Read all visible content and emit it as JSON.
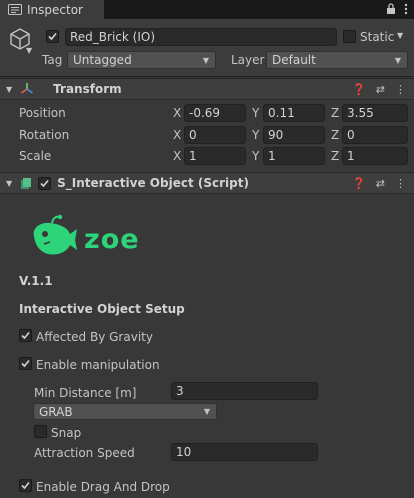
{
  "tab": {
    "title": "Inspector"
  },
  "header": {
    "object_name": "Red_Brick (IO)",
    "active": true,
    "static_label": "Static",
    "static_checked": false,
    "tag_label": "Tag",
    "tag_value": "Untagged",
    "layer_label": "Layer",
    "layer_value": "Default"
  },
  "transform": {
    "title": "Transform",
    "rows": [
      {
        "label": "Position",
        "x": "-0.69",
        "y": "0.11",
        "z": "3.55"
      },
      {
        "label": "Rotation",
        "x": "0",
        "y": "90",
        "z": "0"
      },
      {
        "label": "Scale",
        "x": "1",
        "y": "1",
        "z": "1"
      }
    ],
    "axis": {
      "x": "X",
      "y": "Y",
      "z": "Z"
    }
  },
  "script": {
    "title": "S_Interactive Object (Script)",
    "enabled": true,
    "logo_text": "zoe",
    "version": "V.1.1",
    "section_title": "Interactive Object Setup",
    "affected_by_gravity": {
      "label": "Affected By Gravity",
      "checked": true
    },
    "enable_manipulation": {
      "label": "Enable manipulation",
      "checked": true
    },
    "min_distance": {
      "label": "Min Distance [m]",
      "value": "3"
    },
    "mode": {
      "value": "GRAB"
    },
    "snap": {
      "label": "Snap",
      "checked": false
    },
    "attraction_speed": {
      "label": "Attraction Speed",
      "value": "10"
    },
    "enable_drag_and_drop": {
      "label": "Enable Drag And Drop",
      "checked": true
    }
  },
  "colors": {
    "brand": "#2ed47a",
    "background": "#383838"
  }
}
